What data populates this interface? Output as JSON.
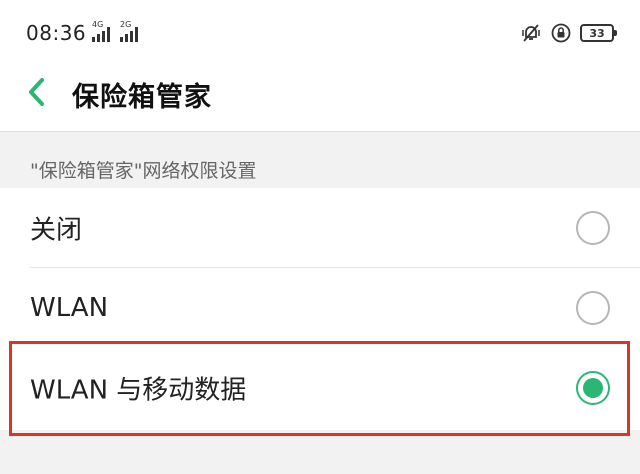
{
  "status_bar": {
    "time": "08:36",
    "signal1_tag": "4G",
    "signal2_tag": "2G",
    "battery": "33"
  },
  "header": {
    "title": "保险箱管家"
  },
  "section": {
    "label": "\"保险箱管家\"网络权限设置"
  },
  "options": [
    {
      "label": "关闭",
      "selected": false
    },
    {
      "label": "WLAN",
      "selected": false
    },
    {
      "label": "WLAN 与移动数据",
      "selected": true
    }
  ],
  "colors": {
    "accent": "#2bb673",
    "highlight": "#d6372a"
  },
  "icons": {
    "back": "chevron-left-icon",
    "mute": "bell-off-icon",
    "lock": "rotation-lock-icon",
    "battery": "battery-icon"
  }
}
